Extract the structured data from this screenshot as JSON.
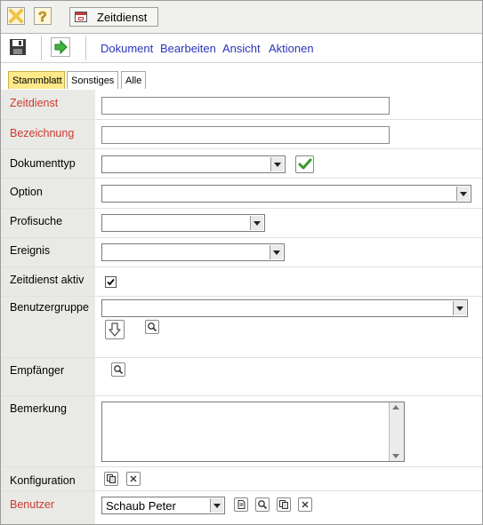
{
  "titlebar": {
    "close_icon": "close-x-icon",
    "help_icon": "help-question-icon",
    "document_tab": "Zeitdienst"
  },
  "toolbar": {
    "save_icon": "save-disk-icon",
    "forward_icon": "green-arrow-right-icon",
    "menu": [
      "Dokument",
      "Bearbeiten",
      "Ansicht",
      "Aktionen"
    ]
  },
  "tabs": [
    "Stammblatt",
    "Sonstiges",
    "Alle"
  ],
  "active_tab": "Stammblatt",
  "form": {
    "zeitdienst": {
      "label": "Zeitdienst",
      "value": ""
    },
    "bezeichnung": {
      "label": "Bezeichnung",
      "value": ""
    },
    "dokumenttyp": {
      "label": "Dokumenttyp",
      "value": ""
    },
    "option": {
      "label": "Option",
      "value": ""
    },
    "profisuche": {
      "label": "Profisuche",
      "value": ""
    },
    "ereignis": {
      "label": "Ereignis",
      "value": ""
    },
    "zeitdienst_aktiv": {
      "label": "Zeitdienst aktiv",
      "checked": true
    },
    "benutzergruppe": {
      "label": "Benutzergruppe",
      "value": ""
    },
    "empfaenger": {
      "label": "Empfänger"
    },
    "bemerkung": {
      "label": "Bemerkung",
      "value": ""
    },
    "konfiguration": {
      "label": "Konfiguration"
    },
    "benutzer": {
      "label": "Benutzer",
      "value": "Schaub Peter"
    }
  },
  "colors": {
    "required_label": "#cc3a2e",
    "menu_link": "#2a35b8",
    "active_tab": "#ffe98a",
    "label_column": "#e9e9e6"
  }
}
